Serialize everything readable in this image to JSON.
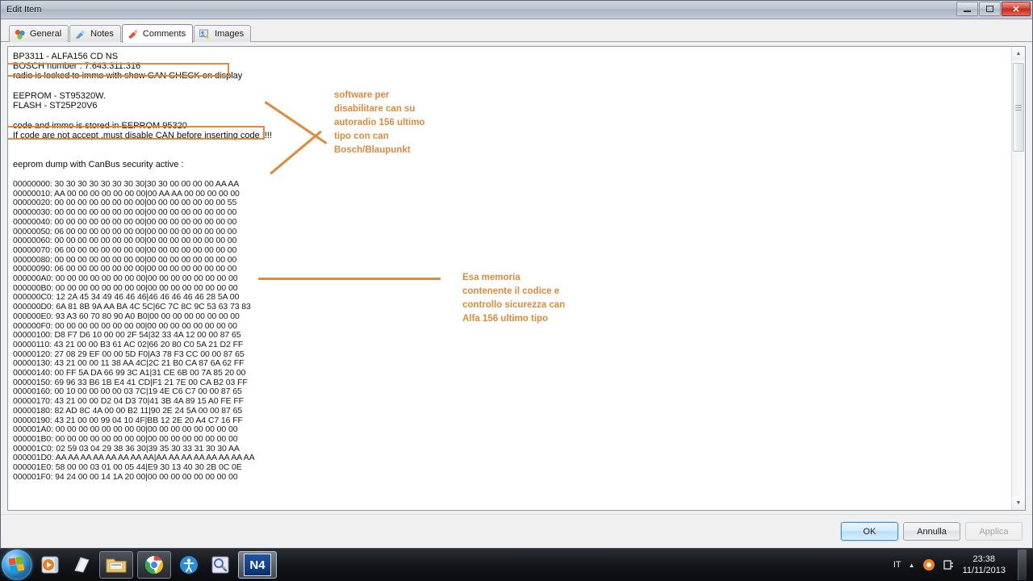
{
  "window": {
    "title": "Edit Item",
    "minimize_label": "Minimize",
    "maximize_label": "Restore",
    "close_label": "Close"
  },
  "tabs": [
    {
      "label": "General",
      "icon": "blocks-icon",
      "active": false
    },
    {
      "label": "Notes",
      "icon": "pen-icon",
      "active": false
    },
    {
      "label": "Comments",
      "icon": "comment-pen-icon",
      "active": true
    },
    {
      "label": "Images",
      "icon": "images-icon",
      "active": false
    }
  ],
  "document": {
    "header_lines": [
      "BP3311 - ALFA156 CD NS",
      "BOSCH number : 7.643.311.316",
      "radio is locked to immo with show CAN CHECK on display"
    ],
    "chip_lines": [
      "EEPROM - ST95320W.",
      "FLASH - ST25P20V6"
    ],
    "note_lines": [
      "code and immo is stored in EEPROM 95320",
      "If code are not accept ,must disable CAN before inserting code !!!!"
    ],
    "dump_title": "eeprom dump with CanBus security active :",
    "hex_lines": [
      "00000000: 30 30 30 30 30 30 30 30|30 30 00 00 00 00 AA AA",
      "00000010: AA 00 00 00 00 00 00 00|00 AA AA 00 00 00 00 00",
      "00000020: 00 00 00 00 00 00 00 00|00 00 00 00 00 00 00 55",
      "00000030: 00 00 00 00 00 00 00 00|00 00 00 00 00 00 00 00",
      "00000040: 00 00 00 00 00 00 00 00|00 00 00 00 00 00 00 00",
      "00000050: 06 00 00 00 00 00 00 00|00 00 00 00 00 00 00 00",
      "00000060: 00 00 00 00 00 00 00 00|00 00 00 00 00 00 00 00",
      "00000070: 06 00 00 00 00 00 00 00|00 00 00 00 00 00 00 00",
      "00000080: 00 00 00 00 00 00 00 00|00 00 00 00 00 00 00 00",
      "00000090: 06 00 00 00 00 00 00 00|00 00 00 00 00 00 00 00",
      "000000A0: 00 00 00 00 00 00 00 00|00 00 00 00 00 00 00 00",
      "000000B0: 00 00 00 00 00 00 00 00|00 00 00 00 00 00 00 00",
      "000000C0: 12 2A 45 34 49 46 46 46|46 46 46 46 46 28 5A 00",
      "000000D0: 6A 81 8B 9A AA BA 4C 5C|6C 7C 8C 9C 53 63 73 83",
      "000000E0: 93 A3 60 70 80 90 A0 B0|00 00 00 00 00 00 00 00",
      "000000F0: 00 00 00 00 00 00 00 00|00 00 00 00 00 00 00 00",
      "00000100: D8 F7 D6 10 00 00 2F 54|32 33 4A 12 00 00 87 65",
      "00000110: 43 21 00 00 B3 61 AC 02|66 20 80 C0 5A 21 D2 FF",
      "00000120: 27 08 29 EF 00 00 5D F0|A3 78 F3 CC 00 00 87 65",
      "00000130: 43 21 00 00 11 38 AA 4C|2C 21 B0 CA 87 6A 62 FF",
      "00000140: 00 FF 5A DA 66 99 3C A1|31 CE 6B 00 7A 85 20 00",
      "00000150: 69 96 33 B6 1B E4 41 CD|F1 21 7E 00 CA B2 03 FF",
      "00000160: 00 10 00 00 00 00 03 7C|19 4E C6 C7 00 00 87 65",
      "00000170: 43 21 00 00 D2 04 D3 70|41 3B 4A 89 15 A0 FE FF",
      "00000180: 82 AD 8C 4A 00 00 B2 11|90 2E 24 5A 00 00 87 65",
      "00000190: 43 21 00 00 99 04 10 4F|BB 12 2E 20 A4 C7 16 FF",
      "000001A0: 00 00 00 00 00 00 00 00|00 00 00 00 00 00 00 00",
      "000001B0: 00 00 00 00 00 00 00 00|00 00 00 00 00 00 00 00",
      "000001C0: 02 59 03 04 29 38 36 30|39 35 30 33 31 30 30 AA",
      "000001D0: AA AA AA AA AA AA AA AA|AA AA AA AA AA AA AA AA",
      "000001E0: 58 00 00 03 01 00 05 44|E9 30 13 40 30 2B 0C 0E",
      "000001F0: 94 24 00 00 14 1A 20 00|00 00 00 00 00 00 00 00"
    ]
  },
  "annotations": {
    "accent_color": "#e08a3c",
    "note_top": "software per\ndisabilitare can su\nautoradio 156 ultimo\ntipo con can\nBosch/Blaupunkt",
    "note_bottom": "Esa memoria\ncontenente il codice e\ncontrollo sicurezza can\nAlfa 156 ultimo tipo"
  },
  "footer": {
    "ok_label": "OK",
    "cancel_label": "Annulla",
    "apply_label": "Applica"
  },
  "taskbar": {
    "start_label": "Start",
    "items": [
      {
        "name": "media-player-icon",
        "label": "Windows Media Player",
        "state": "plain"
      },
      {
        "name": "notepad-icon",
        "label": "Notepad",
        "state": "plain"
      },
      {
        "name": "folder-explorer-icon",
        "label": "Windows Explorer",
        "state": "framed"
      },
      {
        "name": "chrome-icon",
        "label": "Google Chrome",
        "state": "framed"
      },
      {
        "name": "ease-of-access-icon",
        "label": "Ease of Access",
        "state": "plain"
      },
      {
        "name": "search-tool-icon",
        "label": "Search Tool",
        "state": "plain"
      },
      {
        "name": "n4-app-icon",
        "label": "N4",
        "state": "active"
      }
    ],
    "n4_label": "N4",
    "tray": {
      "language": "IT",
      "time": "23:38",
      "date": "11/11/2013"
    }
  }
}
